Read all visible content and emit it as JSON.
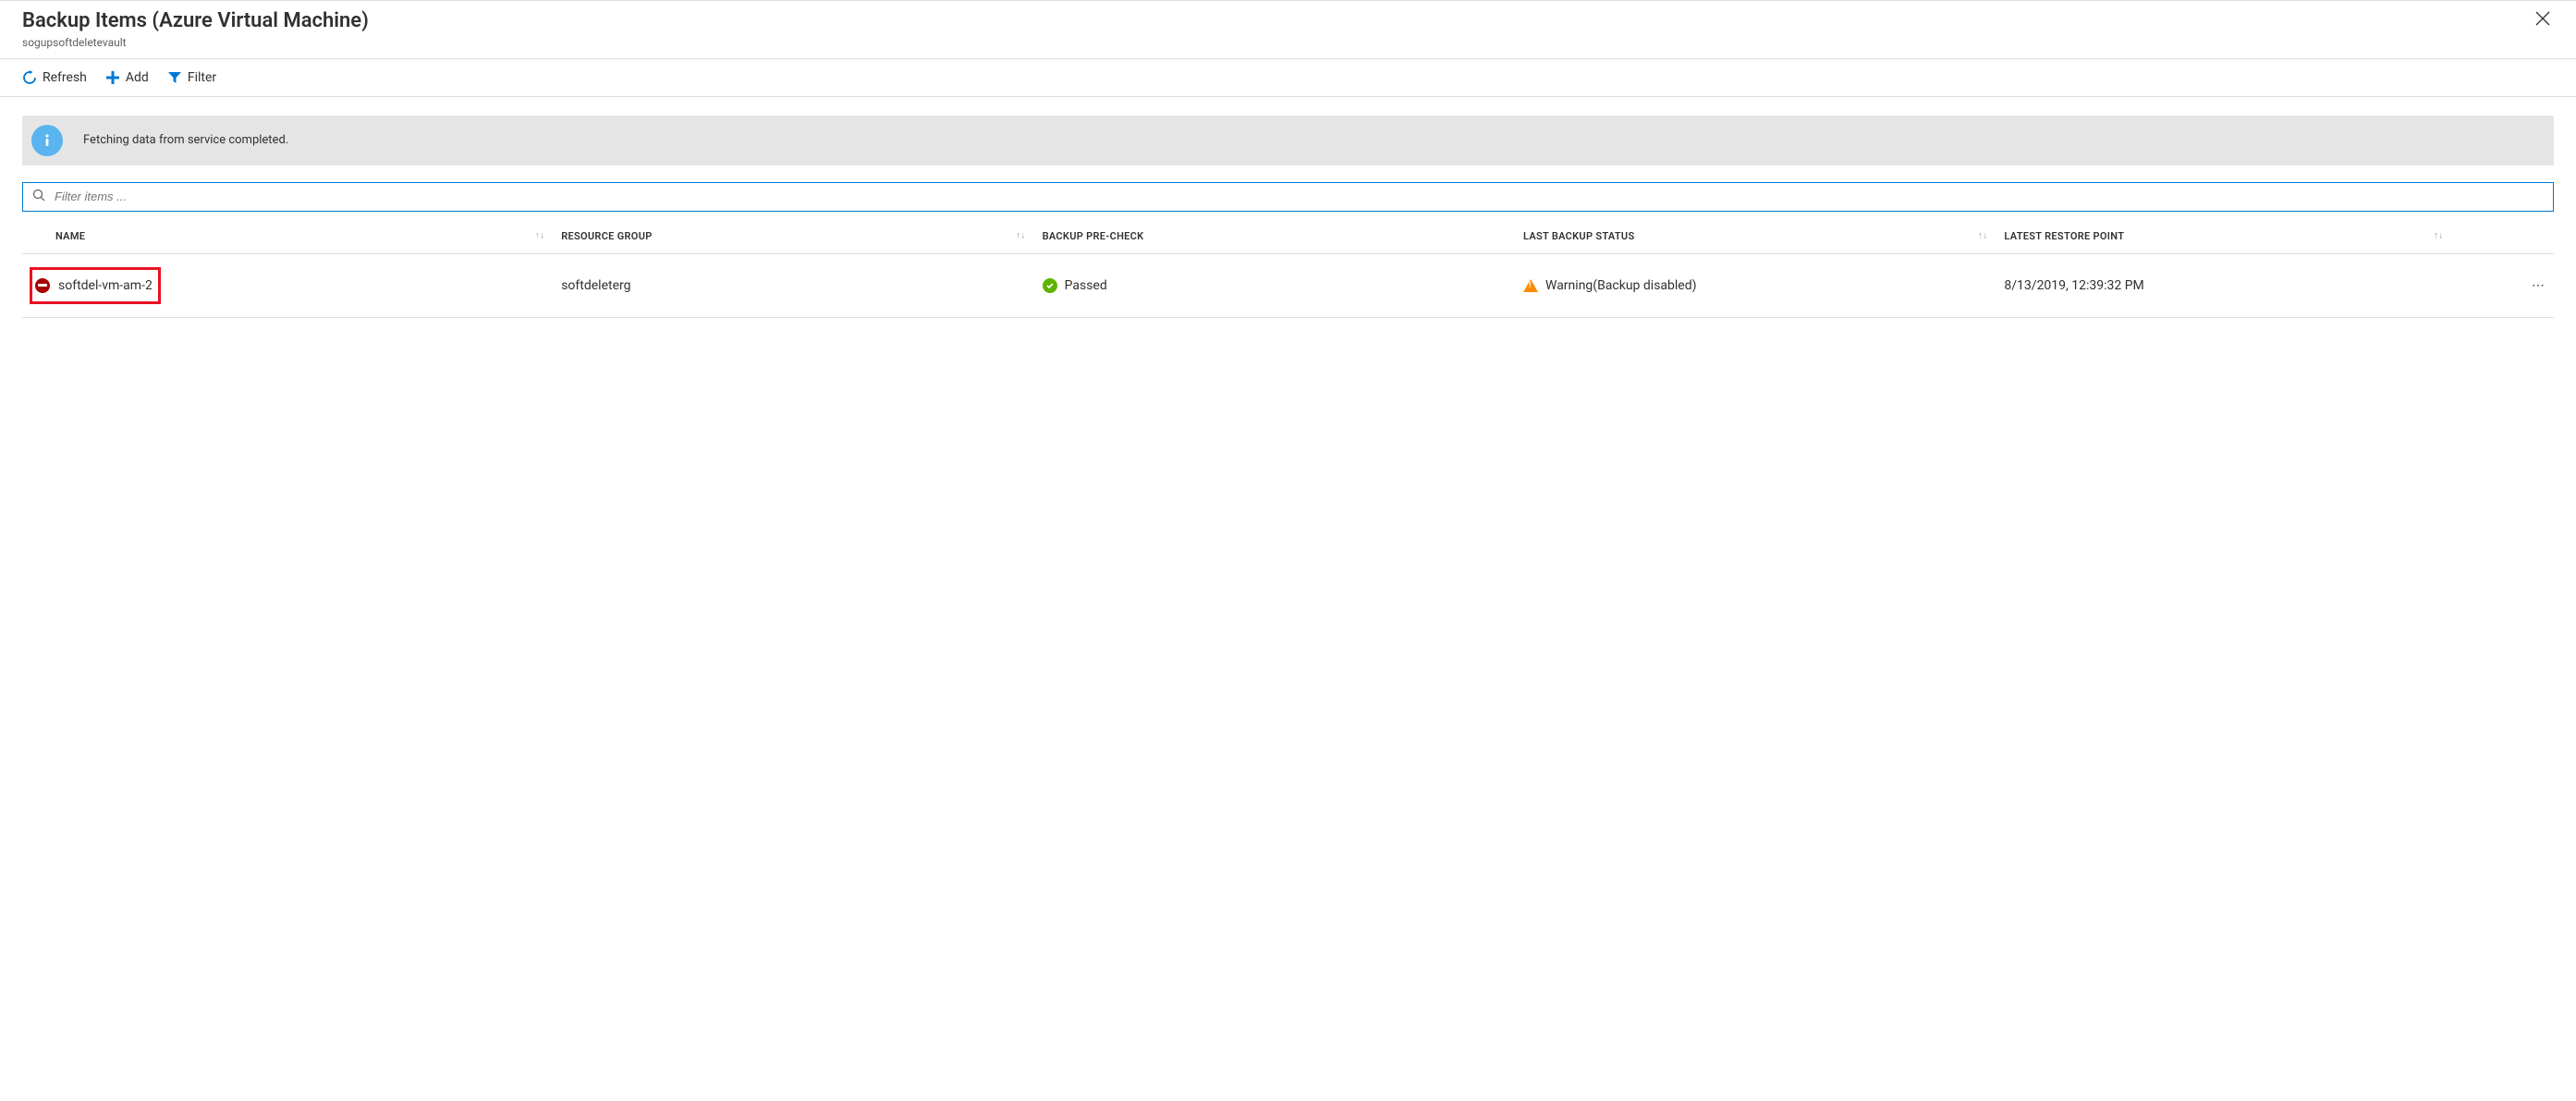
{
  "header": {
    "title": "Backup Items (Azure Virtual Machine)",
    "subtitle": "sogupsoftdeletevault"
  },
  "toolbar": {
    "refresh_label": "Refresh",
    "add_label": "Add",
    "filter_label": "Filter"
  },
  "info": {
    "message": "Fetching data from service completed."
  },
  "filter": {
    "placeholder": "Filter items ..."
  },
  "columns": {
    "name": "NAME",
    "resource_group": "RESOURCE GROUP",
    "backup_precheck": "BACKUP PRE-CHECK",
    "last_backup_status": "LAST BACKUP STATUS",
    "latest_restore_point": "LATEST RESTORE POINT"
  },
  "rows": [
    {
      "name": "softdel-vm-am-2",
      "resource_group": "softdeleterg",
      "precheck": "Passed",
      "status": "Warning(Backup disabled)",
      "restore_point": "8/13/2019, 12:39:32 PM"
    }
  ]
}
